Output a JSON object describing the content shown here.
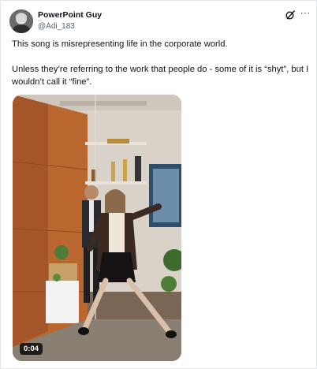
{
  "tweet": {
    "author_name": "PowerPoint Guy",
    "author_handle": "@Adi_183",
    "paragraph_1": "This song is misrepresenting life in the corporate world.",
    "paragraph_2": "Unless they’re referring to the work that people do - some of it is “shyt”, but I wouldn’t call it “fine”.",
    "more_icon": "⋯",
    "grok_icon": "grok-icon"
  },
  "video": {
    "duration": "0:04"
  }
}
